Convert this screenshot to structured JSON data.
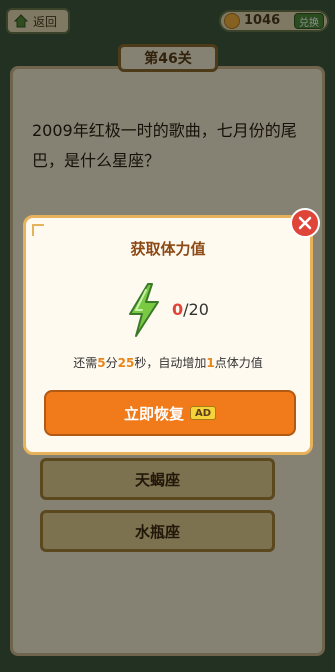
{
  "topbar": {
    "back_label": "返回",
    "coin_count": "1046",
    "redeem_label": "兑换"
  },
  "level": {
    "tab_label": "第46关"
  },
  "question": {
    "text": "2009年红极一时的歌曲，七月份的尾巴，是什么星座？"
  },
  "options": [
    {
      "label": "天蝎座"
    },
    {
      "label": "水瓶座"
    }
  ],
  "modal": {
    "title": "获取体力值",
    "energy_current": "0",
    "energy_max": "/20",
    "countdown": {
      "prefix": "还需",
      "minutes": "5",
      "min_unit": "分",
      "seconds": "25",
      "sec_unit": "秒，自动增加",
      "amount": "1",
      "suffix": "点体力值"
    },
    "recover_label": "立即恢复",
    "ad_label": "AD"
  },
  "colors": {
    "accent": "#f17a1a",
    "highlight": "#e6861b",
    "close": "#e0453a",
    "energy": "#7ac943"
  },
  "icons": [
    "home-icon",
    "coin-icon",
    "close-icon",
    "lightning-bolt-icon"
  ]
}
